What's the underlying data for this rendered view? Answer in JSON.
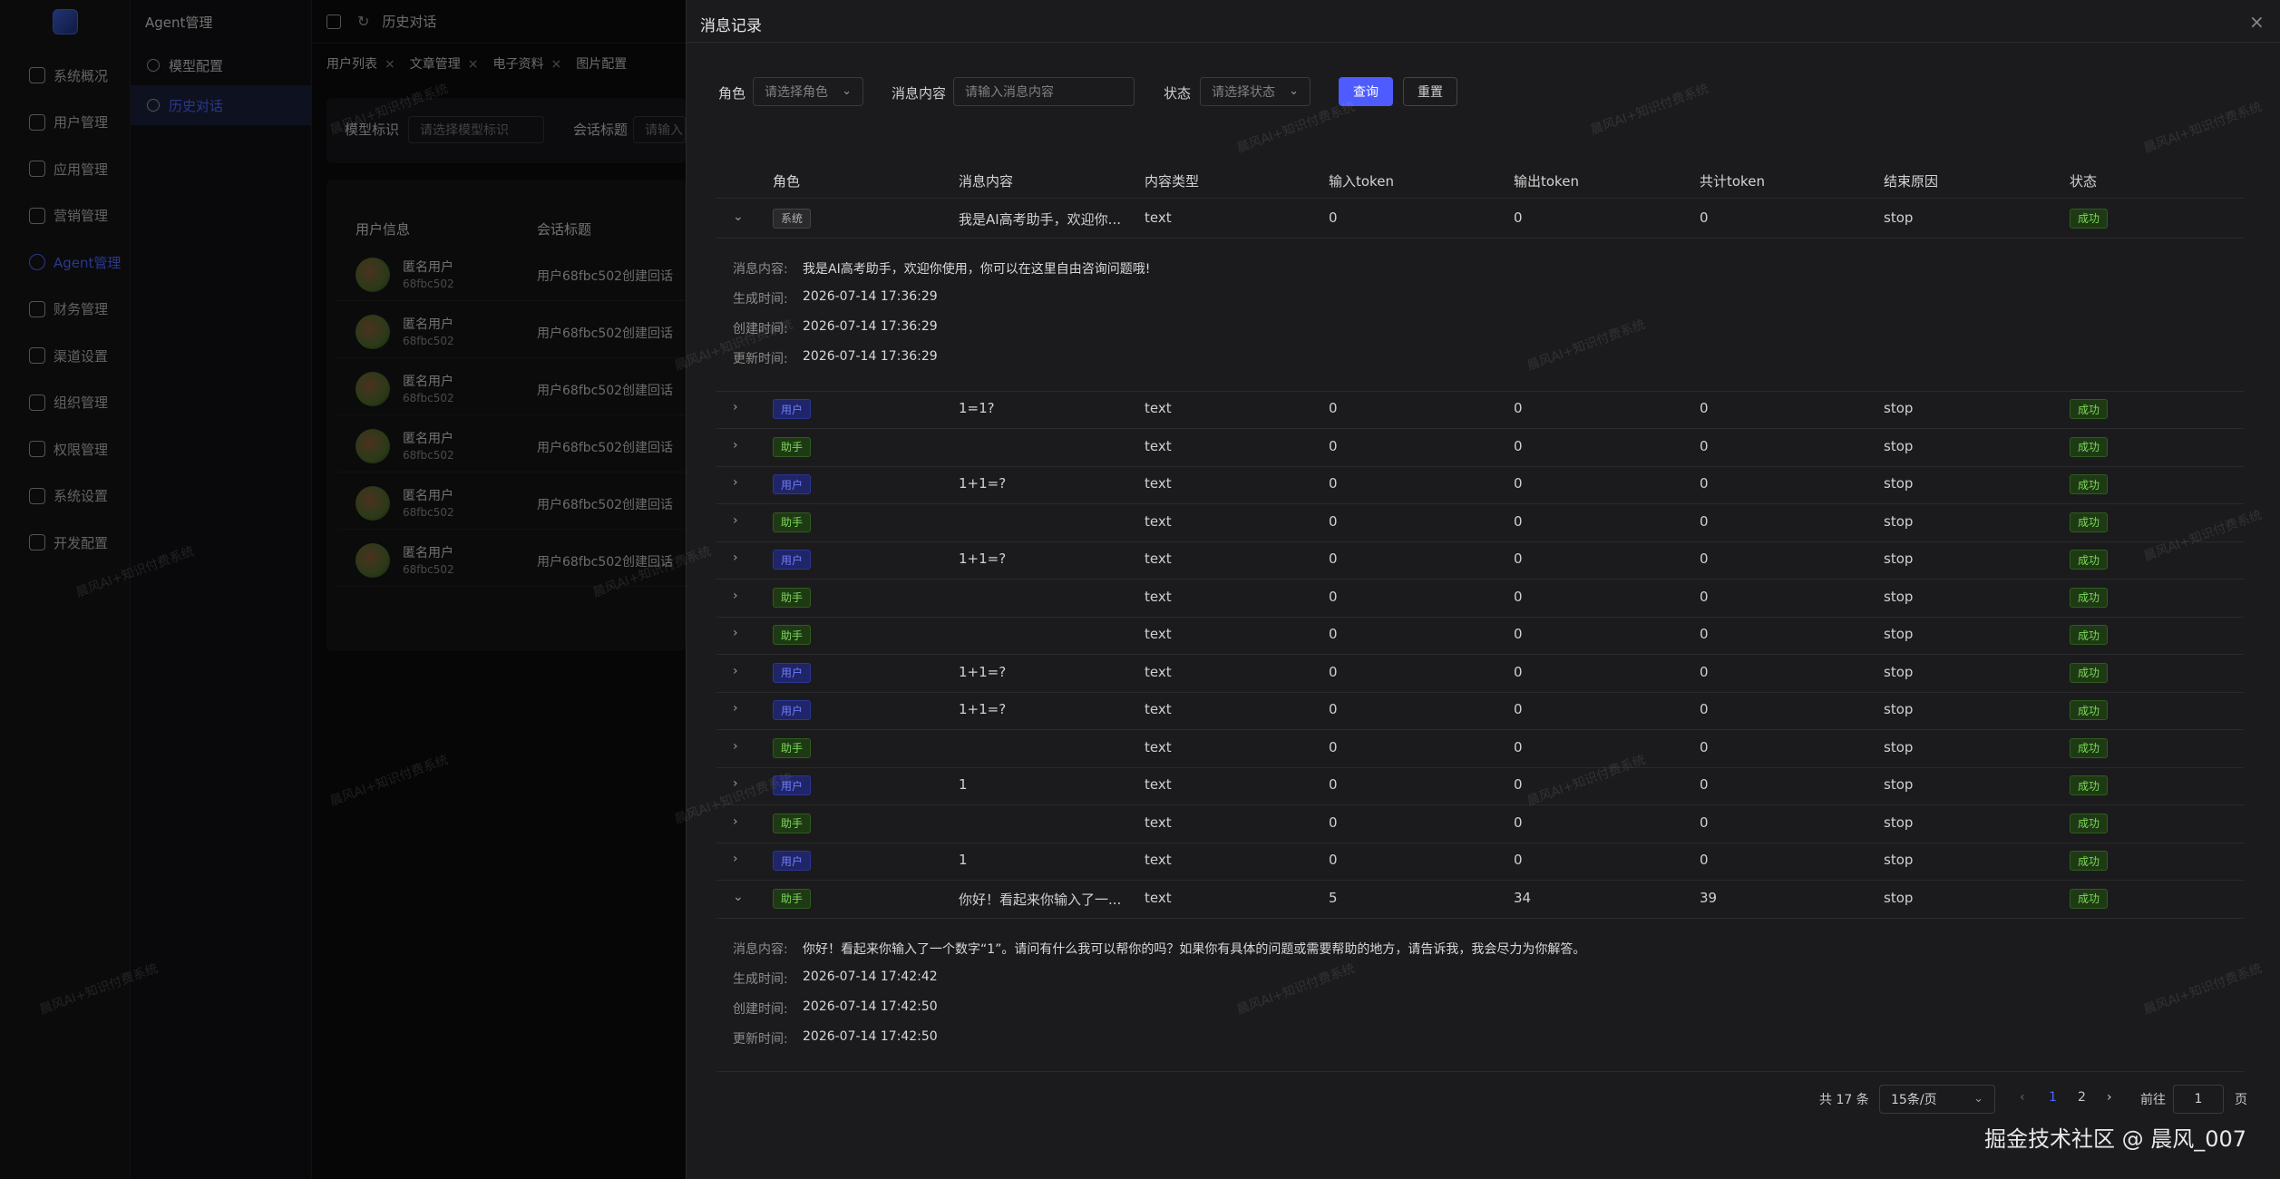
{
  "sidebar": {
    "items": [
      {
        "label": "系统概况",
        "icon": "monitor-icon"
      },
      {
        "label": "用户管理",
        "icon": "user-icon"
      },
      {
        "label": "应用管理",
        "icon": "app-icon"
      },
      {
        "label": "营销管理",
        "icon": "marketing-icon"
      },
      {
        "label": "Agent管理",
        "icon": "agent-icon",
        "active": true
      },
      {
        "label": "财务管理",
        "icon": "finance-icon"
      },
      {
        "label": "渠道设置",
        "icon": "mail-icon"
      },
      {
        "label": "组织管理",
        "icon": "org-icon"
      },
      {
        "label": "权限管理",
        "icon": "permission-icon"
      },
      {
        "label": "系统设置",
        "icon": "gear-icon"
      },
      {
        "label": "开发配置",
        "icon": "dev-icon"
      }
    ]
  },
  "subnav": {
    "title": "Agent管理",
    "items": [
      {
        "label": "模型配置",
        "icon": "gear-icon"
      },
      {
        "label": "历史对话",
        "icon": "history-icon",
        "active": true
      }
    ]
  },
  "topbar": {
    "title": "历史对话"
  },
  "tabs": [
    {
      "label": "用户列表"
    },
    {
      "label": "文章管理"
    },
    {
      "label": "电子资料"
    },
    {
      "label": "图片配置"
    }
  ],
  "bg_filter": {
    "model_label": "模型标识",
    "model_placeholder": "请选择模型标识",
    "title_label": "会话标题",
    "title_placeholder": "请输入"
  },
  "bg_table": {
    "headers": [
      "用户信息",
      "会话标题"
    ],
    "rows": [
      {
        "name": "匿名用户",
        "id": "68fbc502",
        "title": "用户68fbc502创建回话"
      },
      {
        "name": "匿名用户",
        "id": "68fbc502",
        "title": "用户68fbc502创建回话"
      },
      {
        "name": "匿名用户",
        "id": "68fbc502",
        "title": "用户68fbc502创建回话"
      },
      {
        "name": "匿名用户",
        "id": "68fbc502",
        "title": "用户68fbc502创建回话"
      },
      {
        "name": "匿名用户",
        "id": "68fbc502",
        "title": "用户68fbc502创建回话"
      },
      {
        "name": "匿名用户",
        "id": "68fbc502",
        "title": "用户68fbc502创建回话"
      }
    ]
  },
  "drawer": {
    "title": "消息记录",
    "filter": {
      "role_label": "角色",
      "role_placeholder": "请选择角色",
      "content_label": "消息内容",
      "content_placeholder": "请输入消息内容",
      "status_label": "状态",
      "status_placeholder": "请选择状态",
      "query_label": "查询",
      "reset_label": "重置"
    },
    "headers": [
      "角色",
      "消息内容",
      "内容类型",
      "输入token",
      "输出token",
      "共计token",
      "结束原因",
      "状态"
    ],
    "detail_labels": {
      "content": "消息内容:",
      "generated": "生成时间:",
      "created": "创建时间:",
      "updated": "更新时间:"
    },
    "rows": [
      {
        "role": "系统",
        "role_type": "sys",
        "content": "我是AI高考助手，欢迎你...",
        "type": "text",
        "in": "0",
        "out": "0",
        "total": "0",
        "reason": "stop",
        "status": "成功",
        "expanded": true,
        "detail": {
          "content": "我是AI高考助手，欢迎你使用，你可以在这里自由咨询问题哦!",
          "generated": "2026-07-14 17:36:29",
          "created": "2026-07-14 17:36:29",
          "updated": "2026-07-14 17:36:29"
        }
      },
      {
        "role": "用户",
        "role_type": "user",
        "content": "1=1?",
        "type": "text",
        "in": "0",
        "out": "0",
        "total": "0",
        "reason": "stop",
        "status": "成功"
      },
      {
        "role": "助手",
        "role_type": "asst",
        "content": "",
        "type": "text",
        "in": "0",
        "out": "0",
        "total": "0",
        "reason": "stop",
        "status": "成功"
      },
      {
        "role": "用户",
        "role_type": "user",
        "content": "1+1=?",
        "type": "text",
        "in": "0",
        "out": "0",
        "total": "0",
        "reason": "stop",
        "status": "成功"
      },
      {
        "role": "助手",
        "role_type": "asst",
        "content": "",
        "type": "text",
        "in": "0",
        "out": "0",
        "total": "0",
        "reason": "stop",
        "status": "成功"
      },
      {
        "role": "用户",
        "role_type": "user",
        "content": "1+1=?",
        "type": "text",
        "in": "0",
        "out": "0",
        "total": "0",
        "reason": "stop",
        "status": "成功"
      },
      {
        "role": "助手",
        "role_type": "asst",
        "content": "",
        "type": "text",
        "in": "0",
        "out": "0",
        "total": "0",
        "reason": "stop",
        "status": "成功"
      },
      {
        "role": "助手",
        "role_type": "asst",
        "content": "",
        "type": "text",
        "in": "0",
        "out": "0",
        "total": "0",
        "reason": "stop",
        "status": "成功"
      },
      {
        "role": "用户",
        "role_type": "user",
        "content": "1+1=?",
        "type": "text",
        "in": "0",
        "out": "0",
        "total": "0",
        "reason": "stop",
        "status": "成功"
      },
      {
        "role": "用户",
        "role_type": "user",
        "content": "1+1=?",
        "type": "text",
        "in": "0",
        "out": "0",
        "total": "0",
        "reason": "stop",
        "status": "成功"
      },
      {
        "role": "助手",
        "role_type": "asst",
        "content": "",
        "type": "text",
        "in": "0",
        "out": "0",
        "total": "0",
        "reason": "stop",
        "status": "成功"
      },
      {
        "role": "用户",
        "role_type": "user",
        "content": "1",
        "type": "text",
        "in": "0",
        "out": "0",
        "total": "0",
        "reason": "stop",
        "status": "成功"
      },
      {
        "role": "助手",
        "role_type": "asst",
        "content": "",
        "type": "text",
        "in": "0",
        "out": "0",
        "total": "0",
        "reason": "stop",
        "status": "成功"
      },
      {
        "role": "用户",
        "role_type": "user",
        "content": "1",
        "type": "text",
        "in": "0",
        "out": "0",
        "total": "0",
        "reason": "stop",
        "status": "成功"
      },
      {
        "role": "助手",
        "role_type": "asst",
        "content": "你好！看起来你输入了一...",
        "type": "text",
        "in": "5",
        "out": "34",
        "total": "39",
        "reason": "stop",
        "status": "成功",
        "expanded": true,
        "detail": {
          "content": "你好！看起来你输入了一个数字“1”。请问有什么我可以帮你的吗？如果你有具体的问题或需要帮助的地方，请告诉我，我会尽力为你解答。",
          "generated": "2026-07-14 17:42:42",
          "created": "2026-07-14 17:42:50",
          "updated": "2026-07-14 17:42:50"
        }
      }
    ],
    "pagination": {
      "total": "共 17 条",
      "page_size": "15条/页",
      "pages": [
        "1",
        "2"
      ],
      "current": "1",
      "goto_label": "前往",
      "goto_value": "1",
      "goto_suffix": "页"
    }
  },
  "watermark": "晨风AI+知识付费系统",
  "footer_watermark": "掘金技术社区 @ 晨风_007"
}
